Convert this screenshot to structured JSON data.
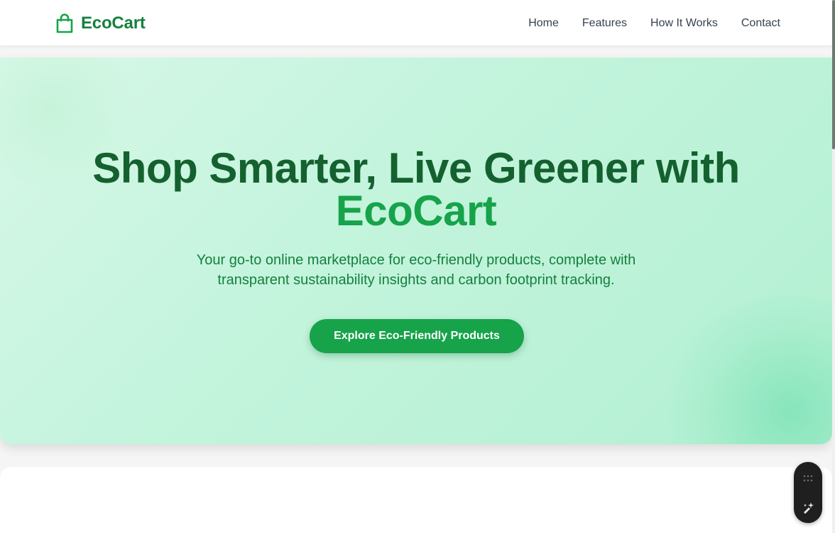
{
  "header": {
    "brand_name": "EcoCart",
    "brand_icon": "shopping-bag-icon",
    "nav": [
      {
        "label": "Home"
      },
      {
        "label": "Features"
      },
      {
        "label": "How It Works"
      },
      {
        "label": "Contact"
      }
    ]
  },
  "hero": {
    "title_main": "Shop Smarter, Live Greener with",
    "title_accent": "EcoCart",
    "subtitle": "Your go-to online marketplace for eco-friendly products, complete with transparent sustainability insights and carbon footprint tracking.",
    "cta_label": "Explore Eco-Friendly Products"
  },
  "floating_toolbar": {
    "icons": [
      "grid-dots-icon",
      "sparkle-edit-icon"
    ]
  },
  "colors": {
    "brand": "#16a34a",
    "brand_dark": "#14612f",
    "hero_bg_start": "#d7f8e7",
    "hero_bg_end": "#b2f0d2",
    "nav_text": "#374151"
  }
}
